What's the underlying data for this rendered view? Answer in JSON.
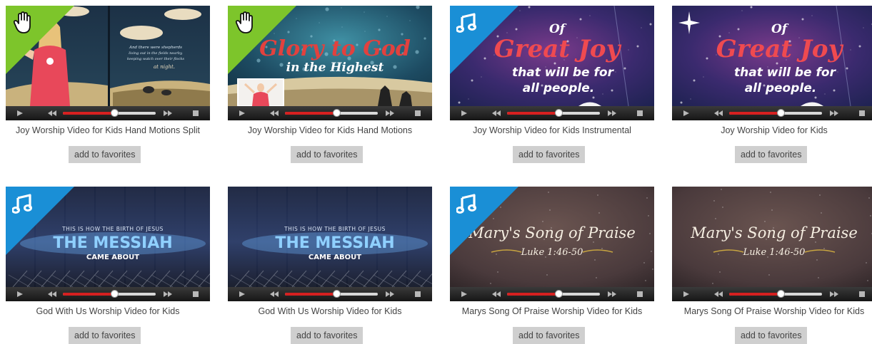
{
  "favorite_label": "add to favorites",
  "colors": {
    "ribbon_green": "#7dc52b",
    "ribbon_blue": "#1a8fd6",
    "progress": "#d62020",
    "button_bg": "#cfcfcf"
  },
  "videos": [
    {
      "title": "Joy Worship Video for Kids Hand Motions Split",
      "badge": "hand-icon",
      "ribbon": "green",
      "art": {
        "theme": "night-split",
        "text_lines": [
          "And there were shepherds",
          "living out in the fields nearby,",
          "keeping watch over their flocks",
          "at night."
        ]
      },
      "progress": 0.55
    },
    {
      "title": "Joy Worship Video for Kids Hand Motions",
      "badge": "hand-icon",
      "ribbon": "green",
      "art": {
        "theme": "glory",
        "text_lines": [
          "Glory to God",
          "in the Highest"
        ]
      },
      "progress": 0.55
    },
    {
      "title": "Joy Worship Video for Kids Instrumental",
      "badge": "music-note-icon",
      "ribbon": "blue",
      "art": {
        "theme": "great-joy",
        "text_lines": [
          "Of",
          "Great Joy",
          "that will be for",
          "all people."
        ]
      },
      "progress": 0.55
    },
    {
      "title": "Joy Worship Video for Kids",
      "badge": "star-icon",
      "ribbon": "none",
      "art": {
        "theme": "great-joy",
        "text_lines": [
          "Of",
          "Great Joy",
          "that will be for",
          "all people."
        ]
      },
      "progress": 0.55
    },
    {
      "title": "God With Us Worship Video for Kids",
      "badge": "music-note-icon",
      "ribbon": "blue",
      "art": {
        "theme": "messiah",
        "text_lines": [
          "THIS IS HOW THE BIRTH OF JESUS",
          "THE MESSIAH",
          "CAME ABOUT"
        ]
      },
      "progress": 0.55
    },
    {
      "title": "God With Us Worship Video for Kids",
      "badge": "none",
      "ribbon": "none",
      "art": {
        "theme": "messiah",
        "text_lines": [
          "THIS IS HOW THE BIRTH OF JESUS",
          "THE MESSIAH",
          "CAME ABOUT"
        ]
      },
      "progress": 0.55
    },
    {
      "title": "Marys Song Of Praise Worship Video for Kids",
      "badge": "music-note-icon",
      "ribbon": "blue",
      "art": {
        "theme": "marys-song",
        "text_lines": [
          "Mary's Song of Praise",
          "Luke 1:46-50"
        ]
      },
      "progress": 0.55
    },
    {
      "title": "Marys Song Of Praise Worship Video for Kids",
      "badge": "none",
      "ribbon": "none",
      "art": {
        "theme": "marys-song",
        "text_lines": [
          "Mary's Song of Praise",
          "Luke 1:46-50"
        ]
      },
      "progress": 0.55
    }
  ]
}
